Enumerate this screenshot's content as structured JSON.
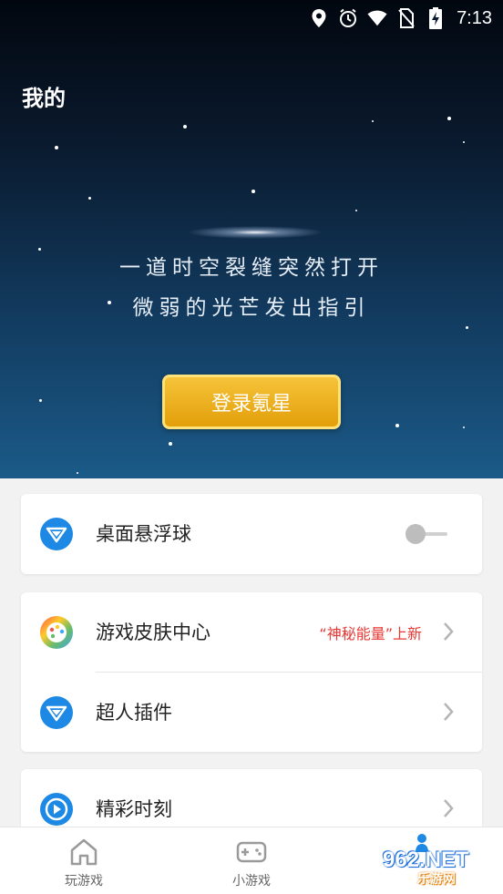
{
  "status_bar": {
    "time": "7:13",
    "icons": [
      "location-icon",
      "alarm-icon",
      "wifi-icon",
      "no-sim-icon",
      "battery-charging-icon"
    ]
  },
  "header": {
    "title": "我的",
    "tagline_line1": "一道时空裂缝突然打开",
    "tagline_line2": "微弱的光芒发出指引",
    "login_button": "登录氪星"
  },
  "cards": {
    "floating_ball": {
      "label": "桌面悬浮球",
      "icon": "shield-v-icon",
      "toggle_on": false
    },
    "skins": {
      "label": "游戏皮肤中心",
      "icon": "palette-icon",
      "promo": "“神秘能量”上新"
    },
    "plugins": {
      "label": "超人插件",
      "icon": "shield-v-icon"
    },
    "highlights": {
      "label": "精彩时刻",
      "icon": "play-icon"
    }
  },
  "tabbar": {
    "tab1": "玩游戏",
    "tab2": "小游戏"
  },
  "watermark": {
    "brand": "962.NET",
    "sub": "乐游网"
  },
  "colors": {
    "accent_blue": "#1e88e5",
    "promo_red": "#e53935",
    "login_gold": "#f0b21f"
  }
}
